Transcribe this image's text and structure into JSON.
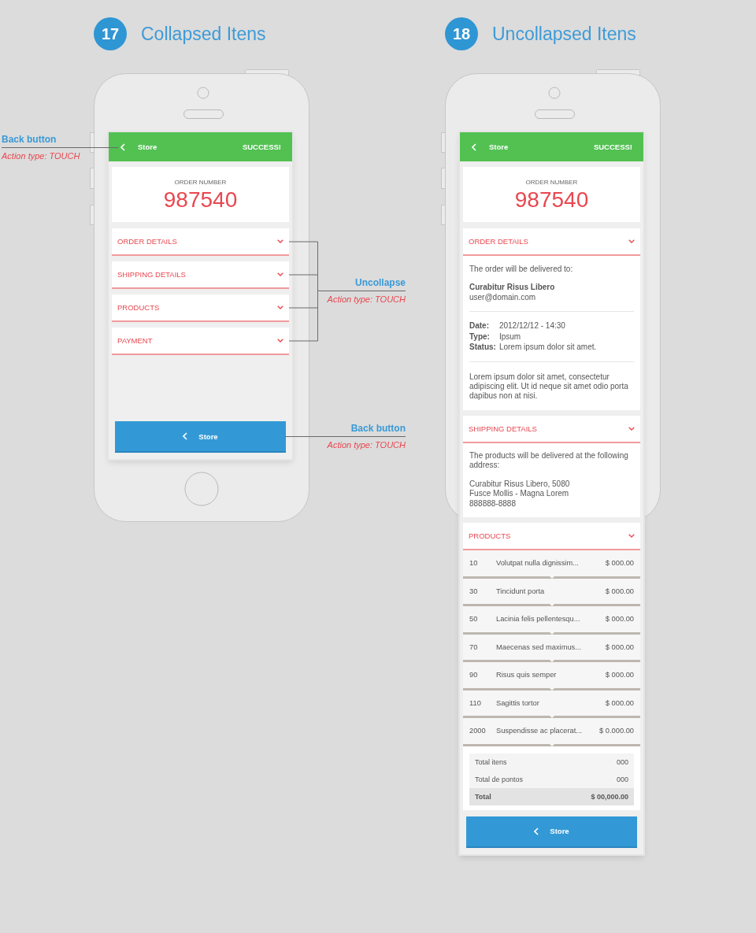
{
  "screens": [
    {
      "number": "17",
      "title": "Collapsed Itens",
      "app_bar": {
        "back_label": "Store",
        "status": "SUCCESS!"
      },
      "order": {
        "label": "ORDER NUMBER",
        "number": "987540"
      },
      "sections": [
        {
          "title": "ORDER DETAILS",
          "expanded": false
        },
        {
          "title": "SHIPPING DETAILS",
          "expanded": false
        },
        {
          "title": "PRODUCTS",
          "expanded": false
        },
        {
          "title": "PAYMENT",
          "expanded": false
        }
      ],
      "footer_button": {
        "label": "Store"
      }
    },
    {
      "number": "18",
      "title": "Uncollapsed Itens",
      "app_bar": {
        "back_label": "Store",
        "status": "SUCCESS!"
      },
      "order": {
        "label": "ORDER NUMBER",
        "number": "987540"
      },
      "sections": [
        {
          "title": "ORDER DETAILS",
          "expanded": true,
          "body": {
            "kind": "details",
            "intro": "The order will be delivered to:",
            "name": "Curabitur Risus Libero",
            "email": "user@domain.com",
            "facts": [
              {
                "label": "Date:",
                "value": "2012/12/12 - 14:30"
              },
              {
                "label": "Type:",
                "value": "Ipsum"
              },
              {
                "label": "Status:",
                "value": "Lorem ipsum dolor sit amet."
              }
            ],
            "note": "Lorem ipsum dolor sit amet, consectetur adipiscing elit. Ut id neque sit amet odio porta dapibus non at nisi."
          }
        },
        {
          "title": "SHIPPING DETAILS",
          "expanded": true,
          "body": {
            "kind": "address",
            "intro": "The products will be delivered at the following address:",
            "lines": [
              "Curabitur Risus Libero, 5080",
              "Fusce Mollis - Magna Lorem",
              "888888-8888"
            ]
          }
        },
        {
          "title": "PRODUCTS",
          "expanded": true,
          "body": {
            "kind": "products",
            "items": [
              {
                "qty": "10",
                "name": "Volutpat nulla dignissim...",
                "price": "$ 000.00"
              },
              {
                "qty": "30",
                "name": "Tincidunt porta",
                "price": "$ 000.00"
              },
              {
                "qty": "50",
                "name": "Lacinia felis pellentesqu...",
                "price": "$ 000.00"
              },
              {
                "qty": "70",
                "name": "Maecenas sed maximus...",
                "price": "$ 000.00"
              },
              {
                "qty": "90",
                "name": "Risus quis semper",
                "price": "$ 000.00"
              },
              {
                "qty": "110",
                "name": "Sagittis tortor",
                "price": "$ 000.00"
              },
              {
                "qty": "2000",
                "name": "Suspendisse ac placerat...",
                "price": "$ 0.000.00"
              }
            ],
            "totals": [
              {
                "kind": "line",
                "label": "Total itens",
                "value": "000"
              },
              {
                "kind": "line",
                "label": "Total de pontos",
                "value": "000"
              },
              {
                "kind": "grand",
                "label": "Total",
                "value": "$ 00,000.00"
              }
            ]
          }
        }
      ],
      "footer_button": {
        "label": "Store"
      }
    }
  ],
  "annotations": [
    {
      "kind": "header",
      "title": "Back button",
      "action": "Action type: TOUCH"
    },
    {
      "kind": "sections",
      "title": "Uncollapse",
      "action": "Action type: TOUCH"
    },
    {
      "kind": "footer",
      "title": "Back button",
      "action": "Action type: TOUCH"
    }
  ]
}
